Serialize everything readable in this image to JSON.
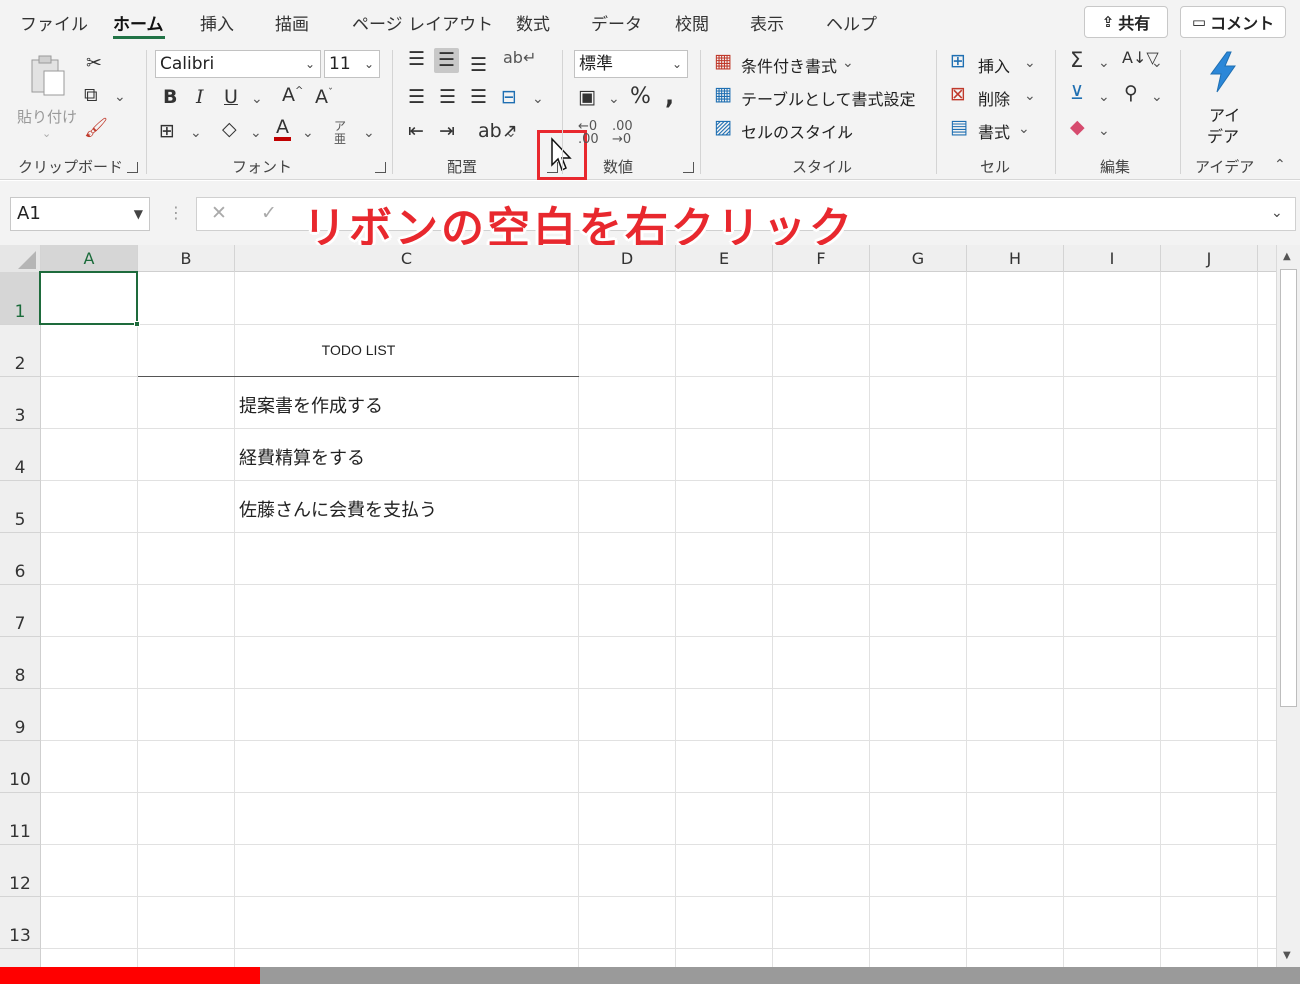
{
  "tabs": [
    "ファイル",
    "ホーム",
    "挿入",
    "描画",
    "ページ レイアウト",
    "数式",
    "データ",
    "校閲",
    "表示",
    "ヘルプ"
  ],
  "active_tab": "ホーム",
  "share_label": "共有",
  "comment_label": "コメント",
  "clipboard": {
    "paste_label": "貼り付け",
    "group": "クリップボード"
  },
  "font": {
    "name": "Calibri",
    "size": "11",
    "group": "フォント"
  },
  "alignment": {
    "group": "配置"
  },
  "number": {
    "format": "標準",
    "group": "数値"
  },
  "styles": {
    "conditional": "条件付き書式",
    "table": "テーブルとして書式設定",
    "cell_styles": "セルのスタイル",
    "group": "スタイル"
  },
  "cells": {
    "insert": "挿入",
    "delete": "削除",
    "format": "書式",
    "group": "セル"
  },
  "editing": {
    "group": "編集"
  },
  "ideas": {
    "line1": "アイ",
    "line2": "デア",
    "group": "アイデア"
  },
  "formula": {
    "namebox": "A1"
  },
  "callout": "リボンの空白を右クリック",
  "columns": [
    "A",
    "B",
    "C",
    "D",
    "E",
    "F",
    "G",
    "H",
    "I",
    "J"
  ],
  "rows": [
    "1",
    "2",
    "3",
    "4",
    "5",
    "6",
    "7",
    "8",
    "9",
    "10",
    "11",
    "12",
    "13"
  ],
  "sheet": {
    "title": "TODO LIST",
    "items": [
      "提案書を作成する",
      "経費精算をする",
      "佐藤さんに会費を支払う"
    ]
  },
  "progress": 0.2,
  "colors": {
    "accent": "#217346",
    "callout": "#e8282e",
    "highlight_box": "#e8282e",
    "progress": "#ff0000"
  }
}
